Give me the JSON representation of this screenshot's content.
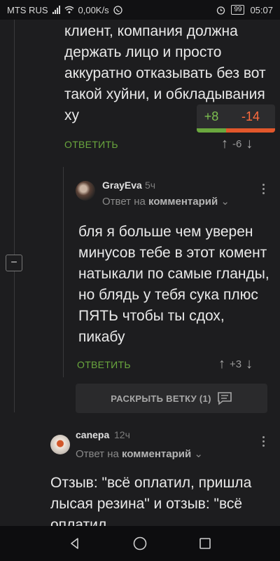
{
  "status_bar": {
    "carrier": "MTS RUS",
    "speed": "0,00K/s",
    "battery": "99",
    "time": "05:07"
  },
  "comment1": {
    "text": "клиент, компания должна держать лицо и просто аккуратно отказывать без вот такой хуйни, и обкладывания ху",
    "reply_label": "ОТВЕТИТЬ",
    "score": "-6",
    "rating_popup": {
      "plus": "+8",
      "minus": "-14"
    }
  },
  "comment2": {
    "username": "GrayEva",
    "time": "5ч",
    "reply_prefix": "Ответ на",
    "reply_target": "комментарий",
    "text": "бля я больше чем уверен минусов тебе в этот комент натыкали по самые гланды, но блядь у тебя сука плюс ПЯТЬ чтобы ты сдох, пикабу",
    "reply_label": "ОТВЕТИТЬ",
    "score": "+3"
  },
  "expand_thread": {
    "label": "РАСКРЫТЬ ВЕТКУ (1)"
  },
  "comment3": {
    "username": "canepa",
    "time": "12ч",
    "reply_prefix": "Ответ на",
    "reply_target": "комментарий",
    "text": "Отзыв: \"всё оплатил, пришла лысая резина\" и отзыв: \"всё оплатил"
  },
  "colors": {
    "accent_green": "#6aa73e",
    "minus_orange": "#e2572b",
    "background": "#1d1d1f"
  }
}
